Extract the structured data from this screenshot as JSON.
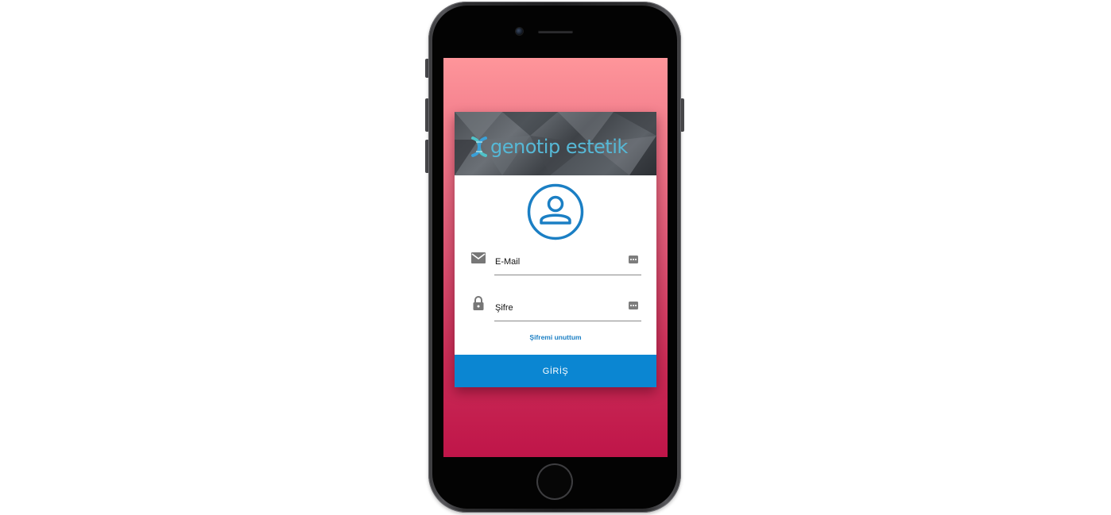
{
  "brand": {
    "name": "genotip estetik",
    "color": "#56b8d6"
  },
  "login": {
    "email_value": "E-Mail",
    "password_value": "Şifre",
    "forgot_label": "Şifremi unuttum",
    "submit_label": "GİRİŞ"
  },
  "colors": {
    "accent": "#0b86d2",
    "background_top": "#fe959a",
    "background_bottom": "#bf1549"
  },
  "icons": {
    "avatar": "user-circle-icon",
    "email": "mail-icon",
    "password": "lock-icon",
    "field_action": "keyboard-icon"
  }
}
